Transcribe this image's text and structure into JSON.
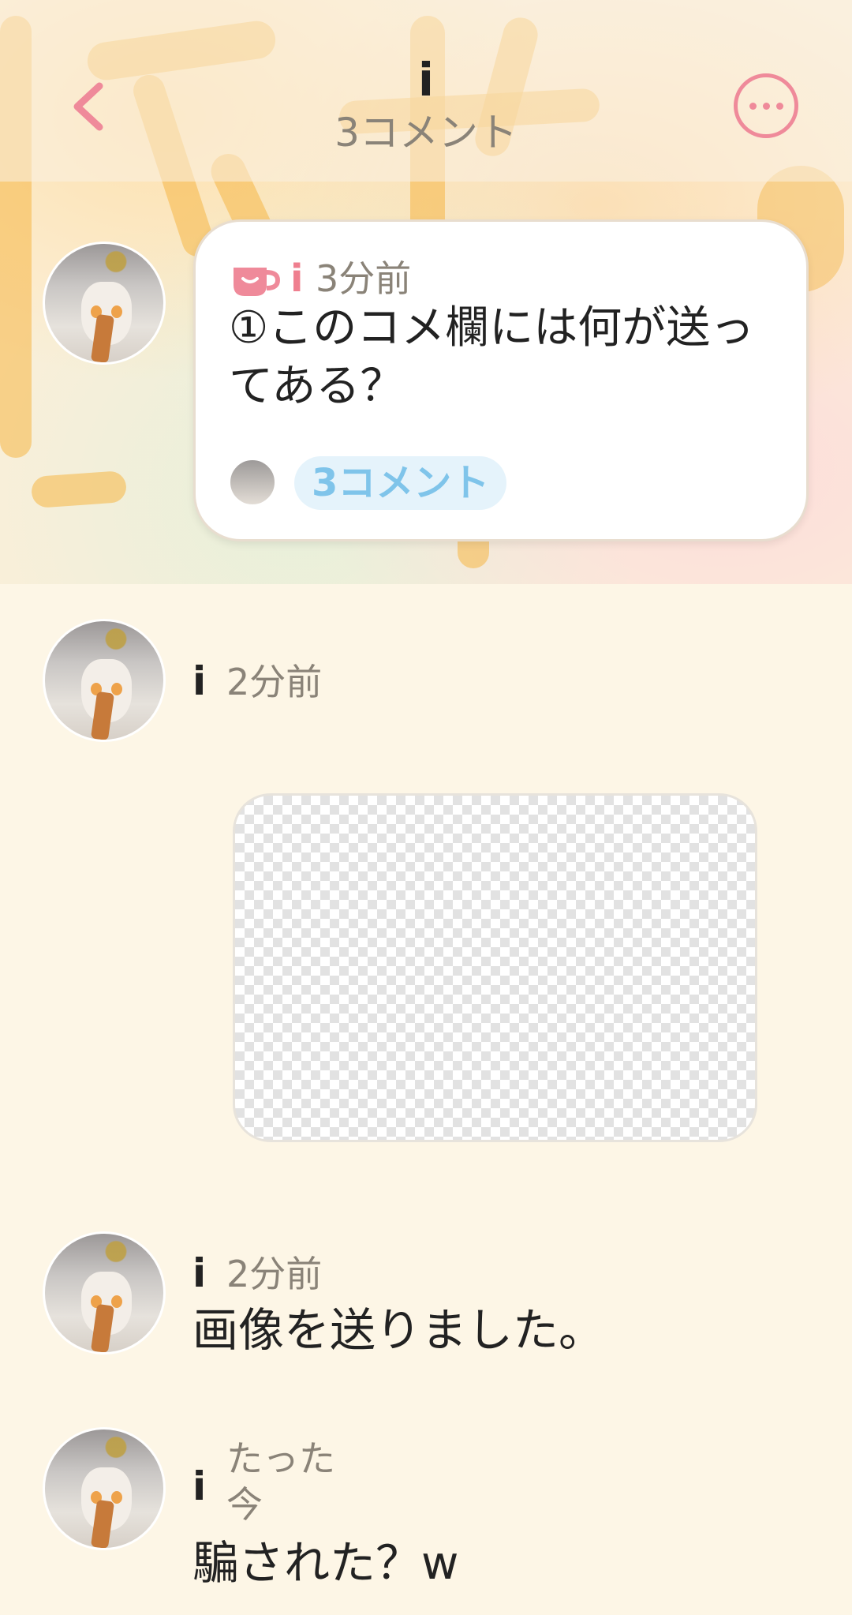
{
  "header": {
    "title": "i",
    "subtitle": "3コメント"
  },
  "post": {
    "user": "i",
    "time": "3分前",
    "body": "①このコメ欄には何が送ってある？",
    "comment_count_label": "3コメント"
  },
  "comments": [
    {
      "user": "i",
      "time": "2分前",
      "text": ""
    },
    {
      "user": "i",
      "time": "2分前",
      "text": "画像を送りました。"
    },
    {
      "user": "i",
      "time_line1": "たった",
      "time_line2": "今",
      "text": "騙された？w"
    }
  ],
  "colors": {
    "accent_pink": "#ef8a9a",
    "comment_pill_text": "#7fc4ea",
    "background": "#fdf6e6"
  }
}
